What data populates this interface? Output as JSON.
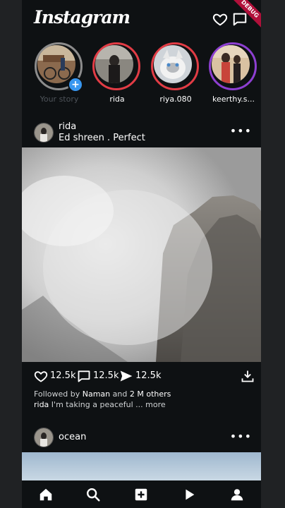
{
  "header": {
    "logo_text": "Instagram",
    "debug_banner": "DEBUG",
    "icons": [
      "heart-icon",
      "chat-icon"
    ]
  },
  "stories": [
    {
      "label": "Your story",
      "ring": "gray",
      "has_add_badge": true
    },
    {
      "label": "rida",
      "ring": "orange"
    },
    {
      "label": "riya.080",
      "ring": "orange"
    },
    {
      "label": "keerthy.s...",
      "ring": "purple"
    }
  ],
  "post1": {
    "username": "rida",
    "subtitle": "Ed shreen . Perfect",
    "more_icon": "•••",
    "likes_count": "12.5k",
    "comments_count": "12.5k",
    "shares_count": "12.5k",
    "followed_prefix": "Followed by ",
    "followed_user": "Naman",
    "followed_and": " and ",
    "followed_others": "2 M others",
    "caption_user": "rida",
    "caption_text": " I'm taking a peaceful ... more"
  },
  "post2": {
    "username": "ocean",
    "more_icon": "•••"
  },
  "bottom_nav": [
    "home-icon",
    "search-icon",
    "add-post-icon",
    "reels-icon",
    "profile-icon"
  ],
  "colors": {
    "background": "#0e1113",
    "outer": "#202224",
    "story_ring_active": "#e23c45",
    "add_badge": "#3897f0",
    "debug": "#b0103a"
  }
}
